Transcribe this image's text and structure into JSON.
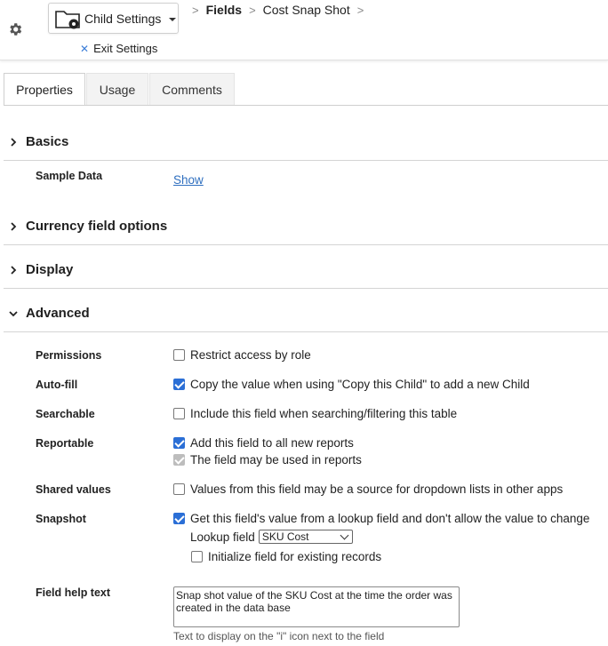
{
  "header": {
    "settings_label": "Child Settings",
    "exit_label": "Exit Settings",
    "breadcrumb": [
      "Fields",
      "Cost Snap Shot"
    ]
  },
  "tabs": [
    "Properties",
    "Usage",
    "Comments"
  ],
  "sections": {
    "basics": "Basics",
    "currency": "Currency field options",
    "display": "Display",
    "advanced": "Advanced"
  },
  "basics": {
    "sample_label": "Sample Data",
    "show_link": "Show"
  },
  "advanced": {
    "permissions_label": "Permissions",
    "permissions_text": "Restrict access by role",
    "autofill_label": "Auto-fill",
    "autofill_text": "Copy the value when using \"Copy this Child\" to add a new Child",
    "searchable_label": "Searchable",
    "searchable_text": "Include this field when searching/filtering this table",
    "reportable_label": "Reportable",
    "reportable_text1": "Add this field to all new reports",
    "reportable_text2": "The field may be used in reports",
    "shared_label": "Shared values",
    "shared_text": "Values from this field may be a source for dropdown lists in other apps",
    "snapshot_label": "Snapshot",
    "snapshot_text": "Get this field's value from a lookup field and don't allow the value to change",
    "lookup_label": "Lookup field",
    "lookup_value": "SKU Cost",
    "init_text": "Initialize field for existing records",
    "help_label": "Field help text",
    "help_value": "Snap shot value of the SKU Cost at the time the order was created in the data base",
    "help_hint": "Text to display on the \"i\" icon next to the field"
  }
}
